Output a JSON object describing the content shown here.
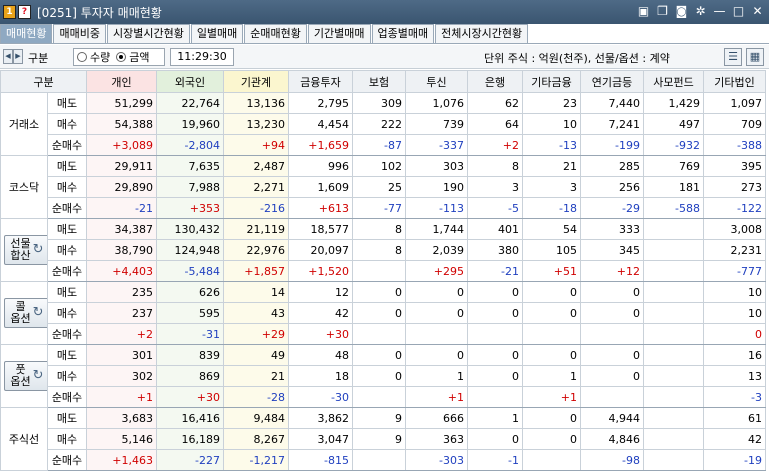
{
  "window": {
    "badge_one": "1",
    "badge_q": "?",
    "title": "[0251] 투자자 매매현황"
  },
  "tabs": [
    "매매현황",
    "매매비중",
    "시장별시간현황",
    "일별매매",
    "순매매현황",
    "기간별매매",
    "업종별매매",
    "전체시장시간현황"
  ],
  "toolbar": {
    "gubun_label": "구분",
    "radio_qty": "수량",
    "radio_amount": "금액",
    "time": "11:29:30",
    "unit": "단위 주식 : 억원(천주), 선물/옵션 : 계약"
  },
  "columns": [
    "구분",
    "개인",
    "외국인",
    "기관계",
    "금융투자",
    "보험",
    "투신",
    "은행",
    "기타금융",
    "연기금등",
    "사모펀드",
    "기타법인"
  ],
  "groups": [
    {
      "label": "거래소",
      "rows": [
        {
          "type": "매도",
          "values": [
            "51,299",
            "22,764",
            "13,136",
            "2,795",
            "309",
            "1,076",
            "62",
            "23",
            "7,440",
            "1,429",
            "1,097"
          ]
        },
        {
          "type": "매수",
          "values": [
            "54,388",
            "19,960",
            "13,230",
            "4,454",
            "222",
            "739",
            "64",
            "10",
            "7,241",
            "497",
            "709"
          ]
        },
        {
          "type": "순매수",
          "values": [
            "+3,089",
            "-2,804",
            "+94",
            "+1,659",
            "-87",
            "-337",
            "+2",
            "-13",
            "-199",
            "-932",
            "-388"
          ]
        }
      ]
    },
    {
      "label": "코스닥",
      "rows": [
        {
          "type": "매도",
          "values": [
            "29,911",
            "7,635",
            "2,487",
            "996",
            "102",
            "303",
            "8",
            "21",
            "285",
            "769",
            "395"
          ]
        },
        {
          "type": "매수",
          "values": [
            "29,890",
            "7,988",
            "2,271",
            "1,609",
            "25",
            "190",
            "3",
            "3",
            "256",
            "181",
            "273"
          ]
        },
        {
          "type": "순매수",
          "values": [
            "-21",
            "+353",
            "-216",
            "+613",
            "-77",
            "-113",
            "-5",
            "-18",
            "-29",
            "-588",
            "-122"
          ]
        }
      ]
    },
    {
      "label": "선물합산",
      "button": true,
      "line1": "선물",
      "line2": "합산",
      "rows": [
        {
          "type": "매도",
          "values": [
            "34,387",
            "130,432",
            "21,119",
            "18,577",
            "8",
            "1,744",
            "401",
            "54",
            "333",
            "",
            "3,008"
          ]
        },
        {
          "type": "매수",
          "values": [
            "38,790",
            "124,948",
            "22,976",
            "20,097",
            "8",
            "2,039",
            "380",
            "105",
            "345",
            "",
            "2,231"
          ]
        },
        {
          "type": "순매수",
          "values": [
            "+4,403",
            "-5,484",
            "+1,857",
            "+1,520",
            "",
            "+295",
            "-21",
            "+51",
            "+12",
            "",
            "-777"
          ]
        }
      ]
    },
    {
      "label": "콜옵션",
      "button": true,
      "line1": "콜",
      "line2": "옵션",
      "rows": [
        {
          "type": "매도",
          "values": [
            "235",
            "626",
            "14",
            "12",
            "0",
            "0",
            "0",
            "0",
            "0",
            "",
            "10"
          ]
        },
        {
          "type": "매수",
          "values": [
            "237",
            "595",
            "43",
            "42",
            "0",
            "0",
            "0",
            "0",
            "0",
            "",
            "10"
          ]
        },
        {
          "type": "순매수",
          "values": [
            "+2",
            "-31",
            "+29",
            "+30",
            "",
            "",
            "",
            "",
            "",
            "",
            "0"
          ]
        }
      ]
    },
    {
      "label": "풋옵션",
      "button": true,
      "line1": "풋",
      "line2": "옵션",
      "rows": [
        {
          "type": "매도",
          "values": [
            "301",
            "839",
            "49",
            "48",
            "0",
            "0",
            "0",
            "0",
            "0",
            "",
            "16"
          ]
        },
        {
          "type": "매수",
          "values": [
            "302",
            "869",
            "21",
            "18",
            "0",
            "1",
            "0",
            "1",
            "0",
            "",
            "13"
          ]
        },
        {
          "type": "순매수",
          "values": [
            "+1",
            "+30",
            "-28",
            "-30",
            "",
            "+1",
            "",
            "+1",
            "",
            "",
            "-3"
          ]
        }
      ]
    },
    {
      "label": "주식선",
      "rows": [
        {
          "type": "매도",
          "values": [
            "3,683",
            "16,416",
            "9,484",
            "3,862",
            "9",
            "666",
            "1",
            "0",
            "4,944",
            "",
            "61"
          ]
        },
        {
          "type": "매수",
          "values": [
            "5,146",
            "16,189",
            "8,267",
            "3,047",
            "9",
            "363",
            "0",
            "0",
            "4,846",
            "",
            "42"
          ]
        },
        {
          "type": "순매수",
          "values": [
            "+1,463",
            "-227",
            "-1,217",
            "-815",
            "",
            "-303",
            "-1",
            "",
            "-98",
            "",
            "-19"
          ]
        }
      ]
    }
  ]
}
